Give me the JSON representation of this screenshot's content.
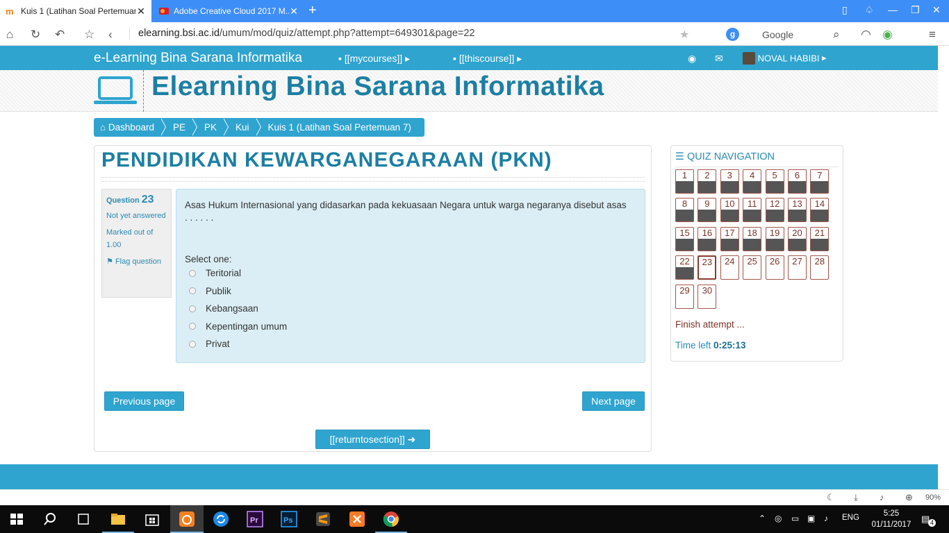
{
  "browser": {
    "tabs": [
      {
        "title": "Kuis 1 (Latihan Soal Pertemuan 7)",
        "active": true
      },
      {
        "title": "Adobe Creative Cloud 2017 M...",
        "active": false
      }
    ],
    "url_host": "elearning.bsi.ac.id",
    "url_path": "/umum/mod/quiz/attempt.php?attempt=649301&page=22",
    "search_label": "Google",
    "zoom": "90%"
  },
  "site": {
    "brand": "e-Learning Bina Sarana Informatika",
    "menu_mycourses": "[[mycourses]]",
    "menu_thiscourse": "[[thiscourse]]",
    "user_name": "NOVAL HABIBI",
    "header_title": "Elearning Bina Sarana Informatika"
  },
  "breadcrumb": {
    "items": [
      "Dashboard",
      "PE",
      "PK",
      "Kui",
      "Kuis 1 (Latihan Soal Pertemuan 7)"
    ]
  },
  "course": {
    "title": "PENDIDIKAN KEWARGANEGARAAN (PKN)"
  },
  "question": {
    "label": "Question",
    "number": "23",
    "state": "Not yet answered",
    "marked": "Marked out of 1.00",
    "flag": "Flag question",
    "text": "Asas Hukum Internasional yang didasarkan pada kekuasaan Negara untuk warga negaranya disebut asas . . . . . .",
    "prompt": "Select one:",
    "options": [
      "Teritorial",
      "Publik",
      "Kebangsaan",
      "Kepentingan umum",
      "Privat"
    ]
  },
  "buttons": {
    "previous": "Previous page",
    "next": "Next page",
    "return": "[[returntosection]]"
  },
  "quiz_nav": {
    "title": "QUIZ NAVIGATION",
    "questions": [
      "1",
      "2",
      "3",
      "4",
      "5",
      "6",
      "7",
      "8",
      "9",
      "10",
      "11",
      "12",
      "13",
      "14",
      "15",
      "16",
      "17",
      "18",
      "19",
      "20",
      "21",
      "22",
      "23",
      "24",
      "25",
      "26",
      "27",
      "28",
      "29",
      "30"
    ],
    "answered_count": 22,
    "current": "23",
    "finish": "Finish attempt ...",
    "time_label": "Time left",
    "time_value": "0:25:13"
  },
  "taskbar": {
    "lang": "ENG",
    "time": "5:25",
    "date": "01/11/2017",
    "notifications": "4"
  }
}
